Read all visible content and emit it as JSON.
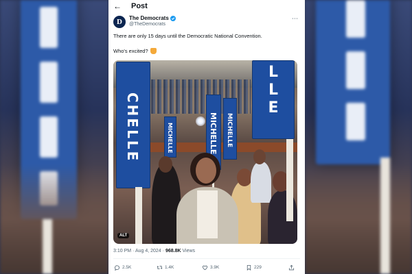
{
  "header": {
    "title": "Post"
  },
  "account": {
    "display_name": "The Democrats",
    "handle": "@TheDemocrats",
    "avatar_letter": "D"
  },
  "tweet": {
    "line1": "There are only 15 days until the Democratic National Convention.",
    "line2": "Who's excited?"
  },
  "photo": {
    "sign_text_michelle": "MICHELLE",
    "sign_text_chelle": "CHELLE",
    "sign_text_lle": "LLE",
    "alt_badge": "ALT"
  },
  "meta": {
    "time": "3:10 PM",
    "separator": "·",
    "date": "Aug 4, 2024",
    "views_count": "968.8K",
    "views_label": "Views"
  },
  "actions": {
    "replies": "2.5K",
    "reposts": "1.4K",
    "likes": "3.9K",
    "bookmarks": "229"
  },
  "colors": {
    "sign_blue": "#1e4ea0",
    "verified_blue": "#1d9bf0",
    "text_primary": "#0f1419",
    "text_secondary": "#536471"
  },
  "icons": [
    "back-arrow-icon",
    "verified-badge-icon",
    "more-icon",
    "raised-hands-icon",
    "reply-icon",
    "repost-icon",
    "like-icon",
    "bookmark-icon",
    "share-icon"
  ]
}
